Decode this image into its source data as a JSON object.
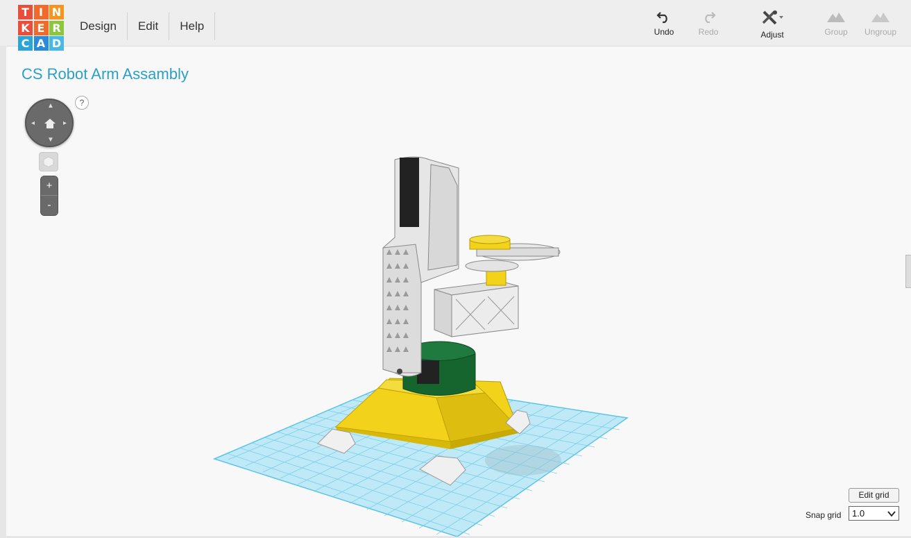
{
  "logo": {
    "letters": [
      "T",
      "I",
      "N",
      "K",
      "E",
      "R",
      "C",
      "A",
      "D"
    ],
    "colors": [
      "#e84e3a",
      "#f26a2b",
      "#f7941d",
      "#e84e3a",
      "#f26a2b",
      "#8cc63f",
      "#2ba4d8",
      "#2b8bd8",
      "#48b9e4"
    ]
  },
  "menu": {
    "items": [
      "Design",
      "Edit",
      "Help"
    ]
  },
  "toolbar": {
    "undo": "Undo",
    "redo": "Redo",
    "adjust": "Adjust",
    "group": "Group",
    "ungroup": "Ungroup"
  },
  "project": {
    "title": "CS Robot Arm Assambly"
  },
  "nav": {
    "help": "?",
    "zoom_in": "+",
    "zoom_out": "-"
  },
  "grid": {
    "edit_label": "Edit grid",
    "snap_label": "Snap grid",
    "snap_value": "1.0"
  },
  "colors": {
    "accent": "#2c9fc6",
    "grid": "#5cc4e6",
    "base_yellow": "#f2d21b",
    "green": "#1a6b3a",
    "white_part": "#e8e8e8",
    "dark_part": "#222222"
  }
}
